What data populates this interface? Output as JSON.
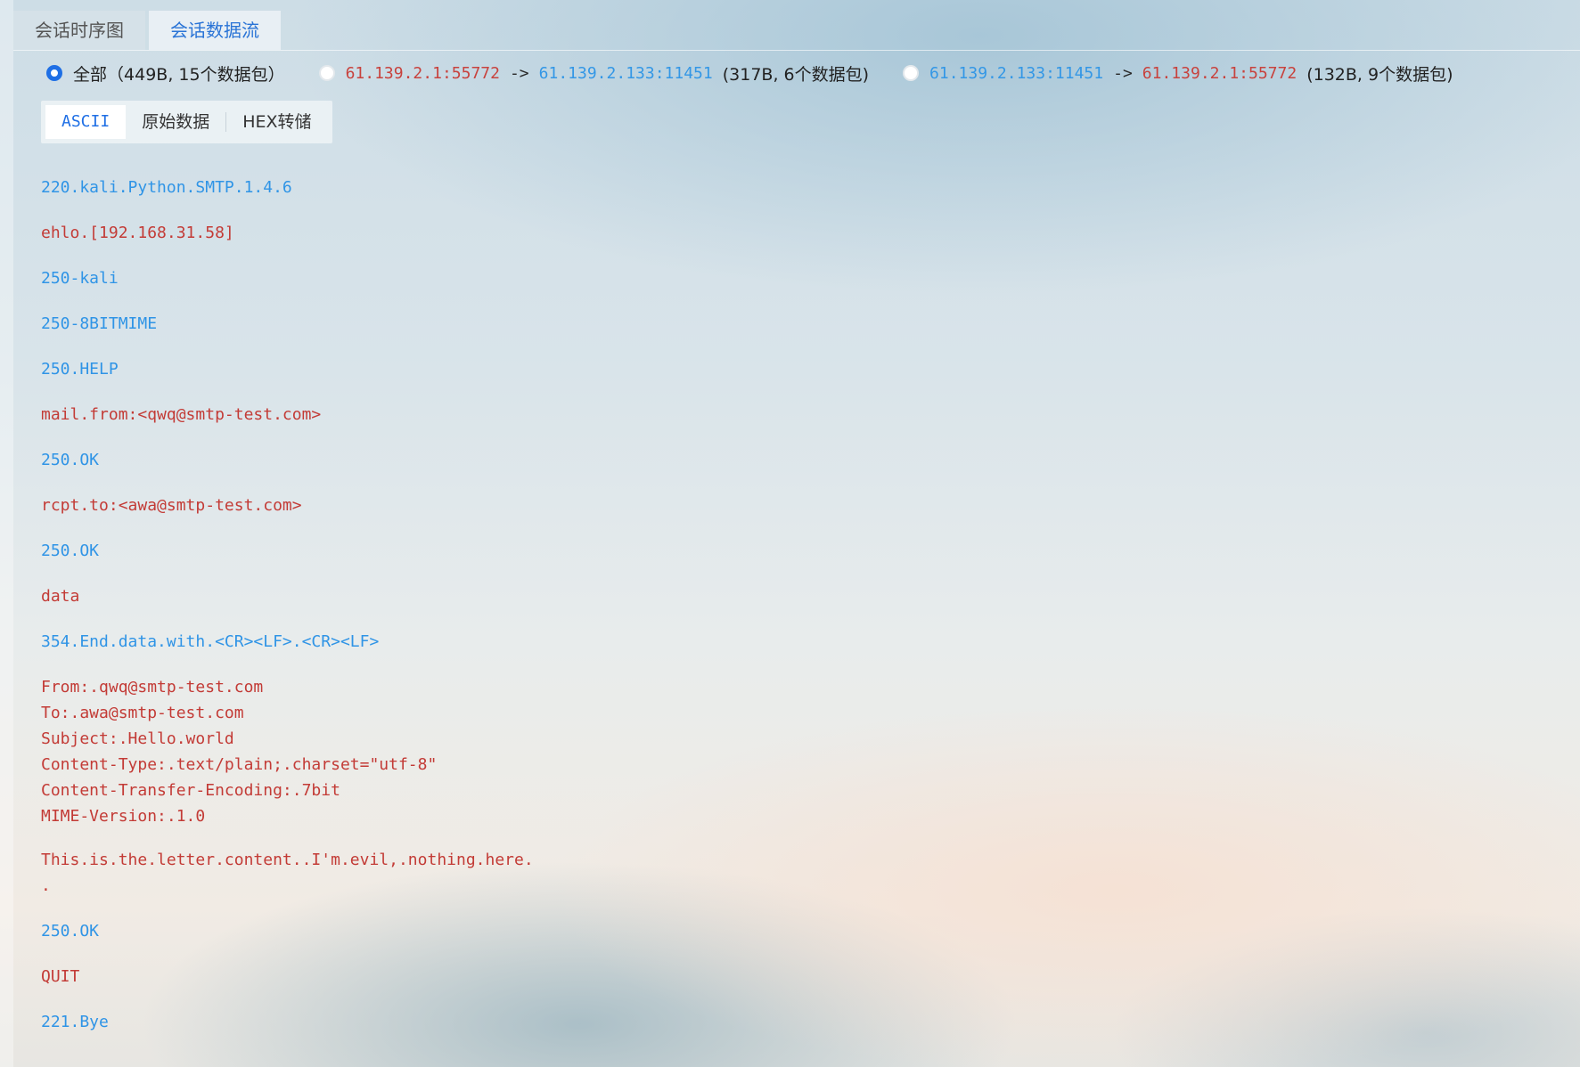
{
  "tabs": [
    {
      "label": "会话时序图",
      "active": false
    },
    {
      "label": "会话数据流",
      "active": true
    }
  ],
  "filter": {
    "all": {
      "label": "全部",
      "stats": "（449B, 15个数据包）",
      "checked": true
    },
    "client_to_server": {
      "src": "61.139.2.1:55772",
      "arrow": "->",
      "dst": "61.139.2.133:11451",
      "stats": "(317B, 6个数据包)",
      "checked": false
    },
    "server_to_client": {
      "src": "61.139.2.133:11451",
      "arrow": "->",
      "dst": "61.139.2.1:55772",
      "stats": "(132B, 9个数据包)",
      "checked": false
    }
  },
  "view_modes": {
    "ascii": "ASCII",
    "raw": "原始数据",
    "hex": "HEX转储",
    "active": "ASCII"
  },
  "colors": {
    "client": "#c33b36",
    "server": "#2f94e6",
    "accent": "#1f6fe5"
  },
  "stream": [
    {
      "dir": "server",
      "lines": [
        "220.kali.Python.SMTP.1.4.6"
      ]
    },
    {
      "dir": "client",
      "lines": [
        "ehlo.[192.168.31.58]"
      ]
    },
    {
      "dir": "server",
      "lines": [
        "250-kali"
      ]
    },
    {
      "dir": "server",
      "lines": [
        "250-8BITMIME"
      ]
    },
    {
      "dir": "server",
      "lines": [
        "250.HELP"
      ]
    },
    {
      "dir": "client",
      "lines": [
        "mail.from:<qwq@smtp-test.com>"
      ]
    },
    {
      "dir": "server",
      "lines": [
        "250.OK"
      ]
    },
    {
      "dir": "client",
      "lines": [
        "rcpt.to:<awa@smtp-test.com>"
      ]
    },
    {
      "dir": "server",
      "lines": [
        "250.OK"
      ]
    },
    {
      "dir": "client",
      "lines": [
        "data"
      ]
    },
    {
      "dir": "server",
      "lines": [
        "354.End.data.with.<CR><LF>.<CR><LF>"
      ]
    },
    {
      "dir": "client",
      "lines": [
        "From:.qwq@smtp-test.com",
        "To:.awa@smtp-test.com",
        "Subject:.Hello.world",
        "Content-Type:.text/plain;.charset=\"utf-8\"",
        "Content-Transfer-Encoding:.7bit",
        "MIME-Version:.1.0",
        "",
        "This.is.the.letter.content..I'm.evil,.nothing.here.",
        "."
      ]
    },
    {
      "dir": "server",
      "lines": [
        "250.OK"
      ]
    },
    {
      "dir": "client",
      "lines": [
        "QUIT"
      ]
    },
    {
      "dir": "server",
      "lines": [
        "221.Bye"
      ]
    }
  ]
}
